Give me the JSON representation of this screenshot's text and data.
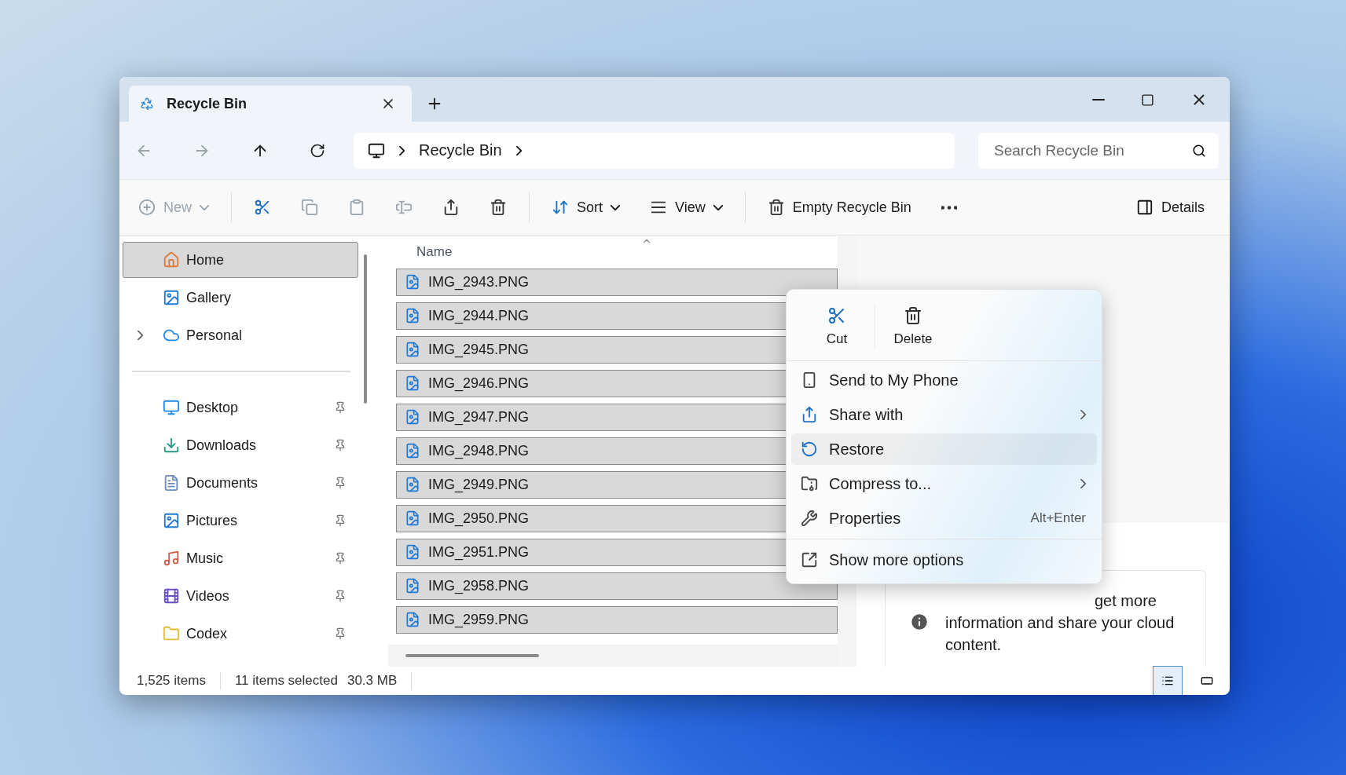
{
  "tabs": [
    {
      "title": "Recycle Bin",
      "selected": true
    }
  ],
  "address": {
    "crumbs": [
      "Recycle Bin"
    ]
  },
  "search": {
    "placeholder": "Search Recycle Bin"
  },
  "toolbar": [
    {
      "kind": "new",
      "label": "New",
      "disabled": true
    },
    {
      "kind": "cut",
      "disabled": false
    },
    {
      "kind": "copy",
      "disabled": true
    },
    {
      "kind": "paste",
      "disabled": true
    },
    {
      "kind": "rename",
      "disabled": true
    },
    {
      "kind": "share",
      "disabled": false
    },
    {
      "kind": "delete",
      "disabled": false
    },
    {
      "kind": "sort",
      "label": "Sort",
      "disabled": false
    },
    {
      "kind": "view",
      "label": "View",
      "disabled": false
    },
    {
      "kind": "empty",
      "label": "Empty Recycle Bin",
      "disabled": false
    },
    {
      "kind": "more",
      "disabled": false
    }
  ],
  "details_button": {
    "label": "Details"
  },
  "sidebar": {
    "top": [
      {
        "kind": "home",
        "label": "Home",
        "selected": true
      },
      {
        "kind": "gallery",
        "label": "Gallery",
        "selected": false
      },
      {
        "kind": "cloud",
        "label": "Personal",
        "selected": false,
        "expanded": false
      }
    ],
    "quick_access": [
      {
        "kind": "desktop",
        "label": "Desktop",
        "pinned": true
      },
      {
        "kind": "downloads",
        "label": "Downloads",
        "pinned": true
      },
      {
        "kind": "documents",
        "label": "Documents",
        "pinned": true
      },
      {
        "kind": "pictures",
        "label": "Pictures",
        "pinned": true
      },
      {
        "kind": "music",
        "label": "Music",
        "pinned": true
      },
      {
        "kind": "videos",
        "label": "Videos",
        "pinned": true
      },
      {
        "kind": "folder",
        "label": "Codex",
        "pinned": true
      }
    ]
  },
  "table": {
    "columns": [
      "Name"
    ],
    "rows": [
      {
        "name": "IMG_2943.PNG",
        "selected": true
      },
      {
        "name": "IMG_2944.PNG",
        "selected": true
      },
      {
        "name": "IMG_2945.PNG",
        "selected": true
      },
      {
        "name": "IMG_2946.PNG",
        "selected": true
      },
      {
        "name": "IMG_2947.PNG",
        "selected": true
      },
      {
        "name": "IMG_2948.PNG",
        "selected": true
      },
      {
        "name": "IMG_2949.PNG",
        "selected": true
      },
      {
        "name": "IMG_2950.PNG",
        "selected": true
      },
      {
        "name": "IMG_2951.PNG",
        "selected": true
      },
      {
        "name": "IMG_2958.PNG",
        "selected": true
      },
      {
        "name": "IMG_2959.PNG",
        "selected": true
      }
    ]
  },
  "context_menu": {
    "quick_actions": [
      {
        "kind": "cut",
        "label": "Cut"
      },
      {
        "kind": "delete",
        "label": "Delete"
      }
    ],
    "items": [
      {
        "kind": "phone",
        "label": "Send to My Phone",
        "submenu": false,
        "highlighted": false
      },
      {
        "kind": "share",
        "label": "Share with",
        "submenu": true,
        "highlighted": false
      },
      {
        "kind": "restore",
        "label": "Restore",
        "submenu": false,
        "highlighted": true
      },
      {
        "kind": "compress",
        "label": "Compress to...",
        "submenu": true,
        "highlighted": false
      },
      {
        "kind": "properties",
        "label": "Properties",
        "shortcut": "Alt+Enter",
        "submenu": false,
        "highlighted": false
      }
    ],
    "footer": {
      "kind": "more",
      "label": "Show more options"
    }
  },
  "details_pane": {
    "message": "get more information and share your cloud content."
  },
  "status_bar": {
    "count": "1,525 items",
    "selection": "11 items selected",
    "size": "30.3 MB",
    "views": [
      {
        "kind": "details",
        "selected": true
      },
      {
        "kind": "tiles",
        "selected": false
      }
    ]
  }
}
